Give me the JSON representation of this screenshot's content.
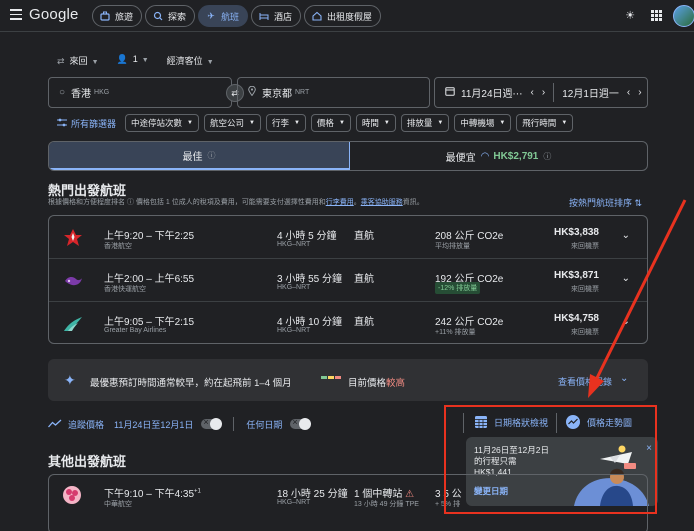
{
  "topbar": {
    "logo": "Google",
    "tabs": [
      {
        "label": "旅遊",
        "icon": "suitcase-icon"
      },
      {
        "label": "探索",
        "icon": "explore-icon"
      },
      {
        "label": "航班",
        "icon": "plane-icon"
      },
      {
        "label": "酒店",
        "icon": "bed-icon"
      },
      {
        "label": "出租度假屋",
        "icon": "home-icon"
      }
    ]
  },
  "search": {
    "trip_type": "來回",
    "passengers": "1",
    "cabin": "經濟客位",
    "origin": "香港",
    "origin_code": "HKG",
    "destination": "東京都",
    "destination_code": "NRT",
    "depart": "11月24日週⋯",
    "return": "12月1日週一"
  },
  "filters": {
    "all": "所有篩選器",
    "chips": [
      "中途停站次數",
      "航空公司",
      "行李",
      "價格",
      "時間",
      "排放量",
      "中轉機場",
      "飛行時間"
    ]
  },
  "sort": {
    "best": "最佳",
    "cheapest": "最便宜",
    "cheapest_price": "HK$2,791"
  },
  "top": {
    "title": "熱門出發航班",
    "subtitle_a": "根據價格和方便程度排名",
    "subtitle_b": "價格包括 1 位成人的稅項及費用，可能需要支付選擇性費用和",
    "subtitle_link1": "行李費用",
    "subtitle_c": "。",
    "subtitle_link2": "乘客協助服務",
    "subtitle_d": "資訊。",
    "sort_link": "按熱門航班排序"
  },
  "flights": [
    {
      "time": "上午9:20 – 下午2:25",
      "airline": "香港航空",
      "duration": "4 小時 5 分鐘",
      "route": "HKG–NRT",
      "stops": "直航",
      "co2": "208 公斤 CO2e",
      "co2_note": "平均排放量",
      "price": "HK$3,838",
      "fare_type": "來回機票"
    },
    {
      "time": "上午2:00 – 上午6:55",
      "airline": "香港快運航空",
      "duration": "3 小時 55 分鐘",
      "route": "HKG–NRT",
      "stops": "直航",
      "co2": "192 公斤 CO2e",
      "co2_note": "-12% 排放量",
      "price": "HK$3,871",
      "fare_type": "來回機票"
    },
    {
      "time": "上午9:05 – 下午2:15",
      "airline": "Greater Bay Airlines",
      "duration": "4 小時 10 分鐘",
      "route": "HKG–NRT",
      "stops": "直航",
      "co2": "242 公斤 CO2e",
      "co2_note": "+11% 排放量",
      "price": "HK$4,758",
      "fare_type": "來回機票"
    }
  ],
  "insight": {
    "tip": "最優惠預訂時間通常較早，約在起飛前 1–4 個月",
    "now_prefix": "目前價格",
    "now_level": "較高",
    "history": "查看價格記錄"
  },
  "track": {
    "label": "追蹤價格",
    "dates": "11月24日至12月1日",
    "any_dates": "任何日期"
  },
  "tools": {
    "grid": "日期格狀檢視",
    "graph": "價格走勢圖"
  },
  "popup": {
    "line1": "11月26日至12月2日",
    "line2": "的行程只需",
    "price": "HK$1,441",
    "cta": "變更日期"
  },
  "other": {
    "title": "其他出發航班",
    "time": "下午9:10 – 下午4:35",
    "plus": "+1",
    "airline": "中華航空",
    "duration": "18 小時 25 分鐘",
    "route": "HKG–NRT",
    "stops": "1 個中轉站",
    "stop_detail": "13 小時 49 分鐘 TPE",
    "co2_partial": "3 5 公",
    "co2_note": "+ 5% 排"
  }
}
